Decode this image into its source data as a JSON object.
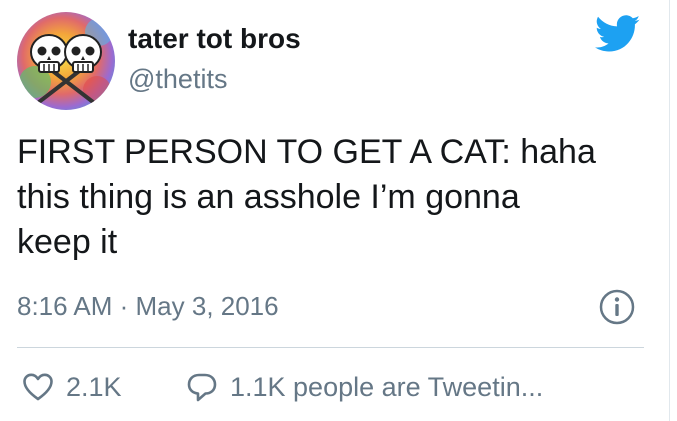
{
  "tweet": {
    "display_name": "tater tot bros",
    "handle": "@thetits",
    "text_lines": [
      "FIRST PERSON TO GET A CAT: haha",
      "this thing is an asshole I’m gonna",
      "keep it"
    ],
    "time": "8:16 AM",
    "separator": " · ",
    "date": "May 3, 2016",
    "likes": "2.1K",
    "conversation": "1.1K people are Tweetin..."
  },
  "icons": {
    "brand": "twitter-bird-icon",
    "info": "info-circle-icon",
    "like": "heart-outline-icon",
    "reply": "speech-bubble-icon"
  },
  "colors": {
    "brand_blue": "#1da1f2",
    "text_primary": "#14171a",
    "text_secondary": "#657786",
    "divider": "#ccd6dd"
  }
}
